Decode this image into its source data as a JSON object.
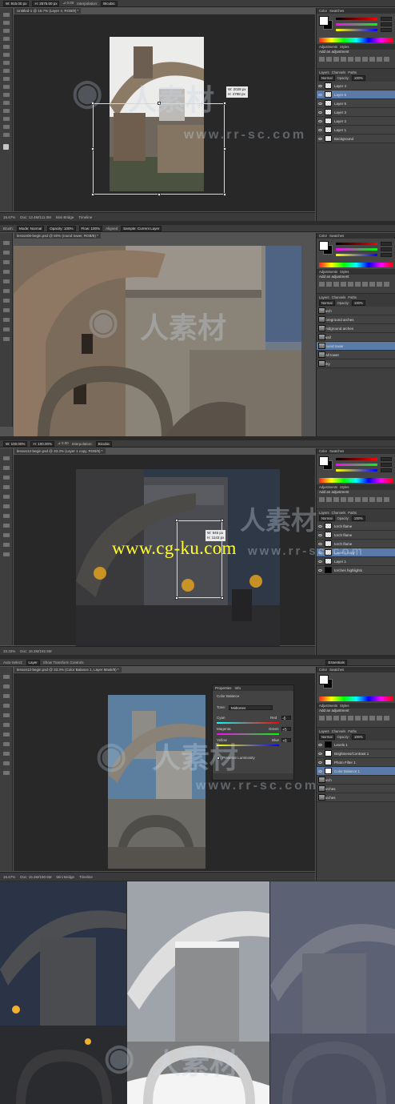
{
  "panels": [
    {
      "options": [
        "W: 915.00 px",
        "H: 2575.00 px",
        "⊿ 0.00",
        "Interpolation:",
        "Bicubic"
      ],
      "tab": "Untitled-1 @ 16.7% (Layer 4, RGB/8) *",
      "status": [
        "16.67%",
        "Doc: 13.4M/111.0M"
      ],
      "bridge": [
        "Mini Bridge",
        "Timeline"
      ],
      "tooltip": [
        "W: 2028 px",
        "H: 4798 px"
      ],
      "layers": [
        {
          "name": "Layer 4",
          "thumb": "check",
          "sel": false
        },
        {
          "name": "Layer 6",
          "thumb": "check",
          "sel": true
        },
        {
          "name": "Layer 5",
          "thumb": "check",
          "sel": false
        },
        {
          "name": "Layer 3",
          "thumb": "check",
          "sel": false
        },
        {
          "name": "Layer 2",
          "thumb": "check",
          "sel": false
        },
        {
          "name": "Layer 1",
          "thumb": "check",
          "sel": false
        },
        {
          "name": "Background",
          "thumb": "white",
          "sel": false
        }
      ]
    },
    {
      "options": [
        "Brush:",
        "Mode: Normal",
        "Opacity: 100%",
        "Flow: 100%",
        "Aligned",
        "Sample: Current Layer"
      ],
      "tab": "lesson05-begin.psd @ 50% (round tower, RGB/8) *",
      "status": [],
      "bridge": [],
      "layers": [
        {
          "name": "arch",
          "thumb": "photo",
          "sel": false
        },
        {
          "name": "foreground arches",
          "thumb": "photo",
          "sel": false
        },
        {
          "name": "midground arches",
          "thumb": "photo",
          "sel": false
        },
        {
          "name": "wall",
          "thumb": "photo",
          "sel": false
        },
        {
          "name": "round tower",
          "thumb": "photo",
          "sel": true
        },
        {
          "name": "tall tower",
          "thumb": "photo",
          "sel": false
        },
        {
          "name": "sky",
          "thumb": "photo",
          "sel": false
        }
      ]
    },
    {
      "options": [
        "W: 100.00%",
        "H: 100.00%",
        "⊿ 0.00",
        "Interpolation:",
        "Bicubic"
      ],
      "tab": "lesson12-begin.psd @ 33.3% (Layer 1 copy, RGB/8) *",
      "status": [
        "33.33%",
        "Doc: 16.2M/192.5M"
      ],
      "bridge": [],
      "tooltip": [
        "W: 946 px",
        "H: 1143 px"
      ],
      "layers": [
        {
          "name": "torch flame",
          "thumb": "check",
          "sel": false
        },
        {
          "name": "torch flame",
          "thumb": "check",
          "sel": false
        },
        {
          "name": "torch flame",
          "thumb": "check",
          "sel": false
        },
        {
          "name": "Layer 1 copy",
          "thumb": "check",
          "sel": true
        },
        {
          "name": "Layer 1",
          "thumb": "check",
          "sel": false
        },
        {
          "name": "torches highlights",
          "thumb": "mask",
          "sel": false
        }
      ]
    },
    {
      "options": [
        "Auto-Select:",
        "Layer",
        "Show Transform Controls"
      ],
      "tab": "lesson12-begin.psd @ 33.3% (Color Balance 1, Layer Mask/8) *",
      "status": [
        "16.67%",
        "Doc: 16.2M/190.5M"
      ],
      "bridge": [
        "Mini Bridge",
        "Timeline"
      ],
      "layers": [
        {
          "name": "Levels 1",
          "thumb": "mask",
          "sel": false
        },
        {
          "name": "Brightness/Contrast 1",
          "thumb": "maskw",
          "sel": false
        },
        {
          "name": "Photo Filter 1",
          "thumb": "adj",
          "sel": false
        },
        {
          "name": "Color Balance 1",
          "thumb": "maskw",
          "sel": true
        },
        {
          "name": "arch",
          "thumb": "photo",
          "sel": false
        },
        {
          "name": "arches",
          "thumb": "photo",
          "sel": false
        },
        {
          "name": "arches",
          "thumb": "photo",
          "sel": false
        }
      ]
    }
  ],
  "dock": {
    "tabs_top": [
      "Color",
      "Swatches"
    ],
    "adjustments_title": "Add an adjustment",
    "adjustments_tabs": [
      "Adjustments",
      "Styles"
    ],
    "layers_tabs": [
      "Layers",
      "Channels",
      "Paths"
    ],
    "blend": "Normal",
    "opacity_label": "Opacity:",
    "opacity": "100%",
    "fill_label": "Fill:",
    "fill": "100%",
    "lock_label": "Lock:",
    "workspace": "Essentials"
  },
  "properties": {
    "tabs": [
      "Properties",
      "Info"
    ],
    "title": "Color Balance",
    "tone_label": "Tone:",
    "tone": "Midtones",
    "rows": [
      {
        "left": "Cyan",
        "right": "Red",
        "value": "-6"
      },
      {
        "left": "Magenta",
        "right": "Green",
        "value": "+5"
      },
      {
        "left": "Yellow",
        "right": "Blue",
        "value": "+6"
      }
    ],
    "preserve": "Preserve Luminosity"
  },
  "watermarks": {
    "cn": "人素材",
    "url": "www.rr-sc.com",
    "cgku": "www.cg-ku.com"
  },
  "colors": {
    "ps_bg": "#535353",
    "canvas_bg": "#282828",
    "selection": "#5a7aa8",
    "cgku": "#ffff2a"
  }
}
